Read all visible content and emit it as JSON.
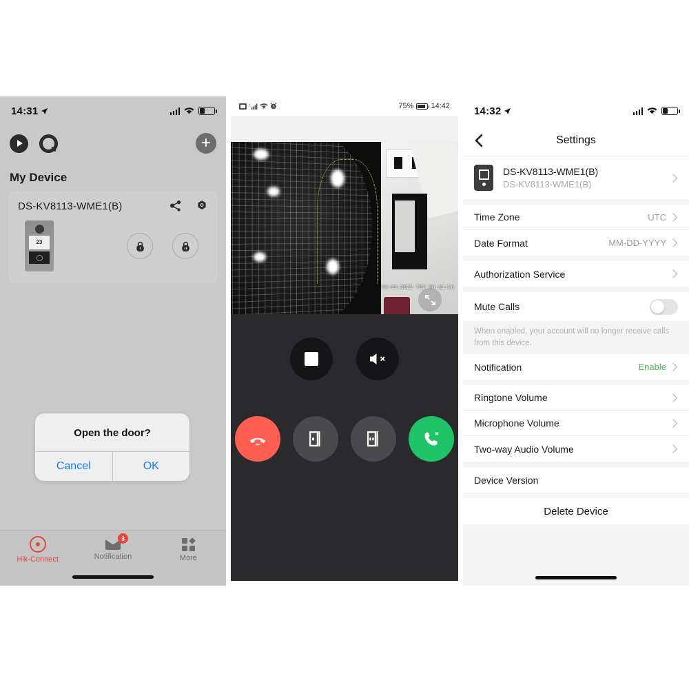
{
  "phone1": {
    "status": {
      "time": "14:31",
      "location_icon": "location-arrow-icon",
      "signal_icon": "cellular-signal-icon",
      "wifi_icon": "wifi-icon",
      "battery_icon": "battery-low-icon"
    },
    "toolbar": {
      "play_icon": "live-view-play-icon",
      "search_icon": "search-icon",
      "add_label": "+"
    },
    "section_title": "My Device",
    "device_card": {
      "name": "DS-KV8113-WME1(B)",
      "share_icon": "share-icon",
      "settings_icon": "gear-icon",
      "thumbnail_label": "23",
      "lock1_icon": "lock-icon",
      "lock2_icon": "lock-icon"
    },
    "dialog": {
      "title": "Open the door?",
      "cancel": "Cancel",
      "ok": "OK"
    },
    "tabs": [
      {
        "label": "Hik-Connect",
        "icon": "hik-connect-icon",
        "active": true,
        "badge": ""
      },
      {
        "label": "Notification",
        "icon": "mail-icon",
        "active": false,
        "badge": "3"
      },
      {
        "label": "More",
        "icon": "grid-more-icon",
        "active": false,
        "badge": ""
      }
    ]
  },
  "phone2": {
    "status": {
      "sim_icon": "sim-card-icon",
      "signal_icon": "cellular-signal-icon",
      "wifi_icon": "wifi-icon",
      "alarm_icon": "alarm-clock-icon",
      "battery_percent": "75%",
      "time": "14:42"
    },
    "video": {
      "timestamp": "03-03-2022 TUE 00:11:36",
      "fullscreen_icon": "fullscreen-expand-icon"
    },
    "controls": [
      {
        "name": "stop-recording-button",
        "icon": "stop-square-icon",
        "style": "dark"
      },
      {
        "name": "mute-speaker-button",
        "icon": "speaker-mute-icon",
        "style": "dark"
      },
      {
        "name": "hang-up-button",
        "icon": "phone-hangup-icon",
        "style": "red"
      },
      {
        "name": "unlock-door-1-button",
        "icon": "door-open-icon",
        "style": "grey"
      },
      {
        "name": "unlock-door-2-button",
        "icon": "door-open-icon",
        "style": "grey"
      },
      {
        "name": "answer-call-button",
        "icon": "phone-answer-icon",
        "style": "green"
      }
    ]
  },
  "phone3": {
    "status": {
      "time": "14:32",
      "location_icon": "location-arrow-icon",
      "signal_icon": "cellular-signal-icon",
      "wifi_icon": "wifi-icon",
      "battery_icon": "battery-low-icon"
    },
    "nav": {
      "back_icon": "back-chevron-icon",
      "title": "Settings"
    },
    "device": {
      "icon": "doorbell-device-icon",
      "name": "DS-KV8113-WME1(B)",
      "subtitle": "DS-KV8113-WME1(B)",
      "chevron_icon": "chevron-right-icon"
    },
    "groups": [
      {
        "rows": [
          {
            "label": "Time Zone",
            "value": "UTC",
            "type": "chevron"
          },
          {
            "label": "Date Format",
            "value": "MM-DD-YYYY",
            "type": "chevron"
          }
        ]
      },
      {
        "rows": [
          {
            "label": "Authorization Service",
            "value": "",
            "type": "chevron"
          }
        ]
      },
      {
        "rows": [
          {
            "label": "Mute Calls",
            "value": "",
            "type": "toggle",
            "toggle_on": false
          }
        ],
        "hint": "When enabled, your account will no longer receive calls from this device."
      },
      {
        "rows": [
          {
            "label": "Notification",
            "value": "Enable",
            "type": "chevron",
            "value_color": "green"
          }
        ]
      },
      {
        "rows": [
          {
            "label": "Ringtone Volume",
            "value": "",
            "type": "chevron"
          },
          {
            "label": "Microphone Volume",
            "value": "",
            "type": "chevron"
          },
          {
            "label": "Two-way Audio Volume",
            "value": "",
            "type": "chevron"
          }
        ]
      },
      {
        "rows": [
          {
            "label": "Device Version",
            "value": "",
            "type": "plain"
          }
        ]
      }
    ],
    "delete_label": "Delete Device"
  },
  "colors": {
    "accent_red": "#e8453c",
    "link_blue": "#0a7cff",
    "green": "#4caf50",
    "answer_green": "#1ec466",
    "hangup_red": "#ff5f52"
  }
}
